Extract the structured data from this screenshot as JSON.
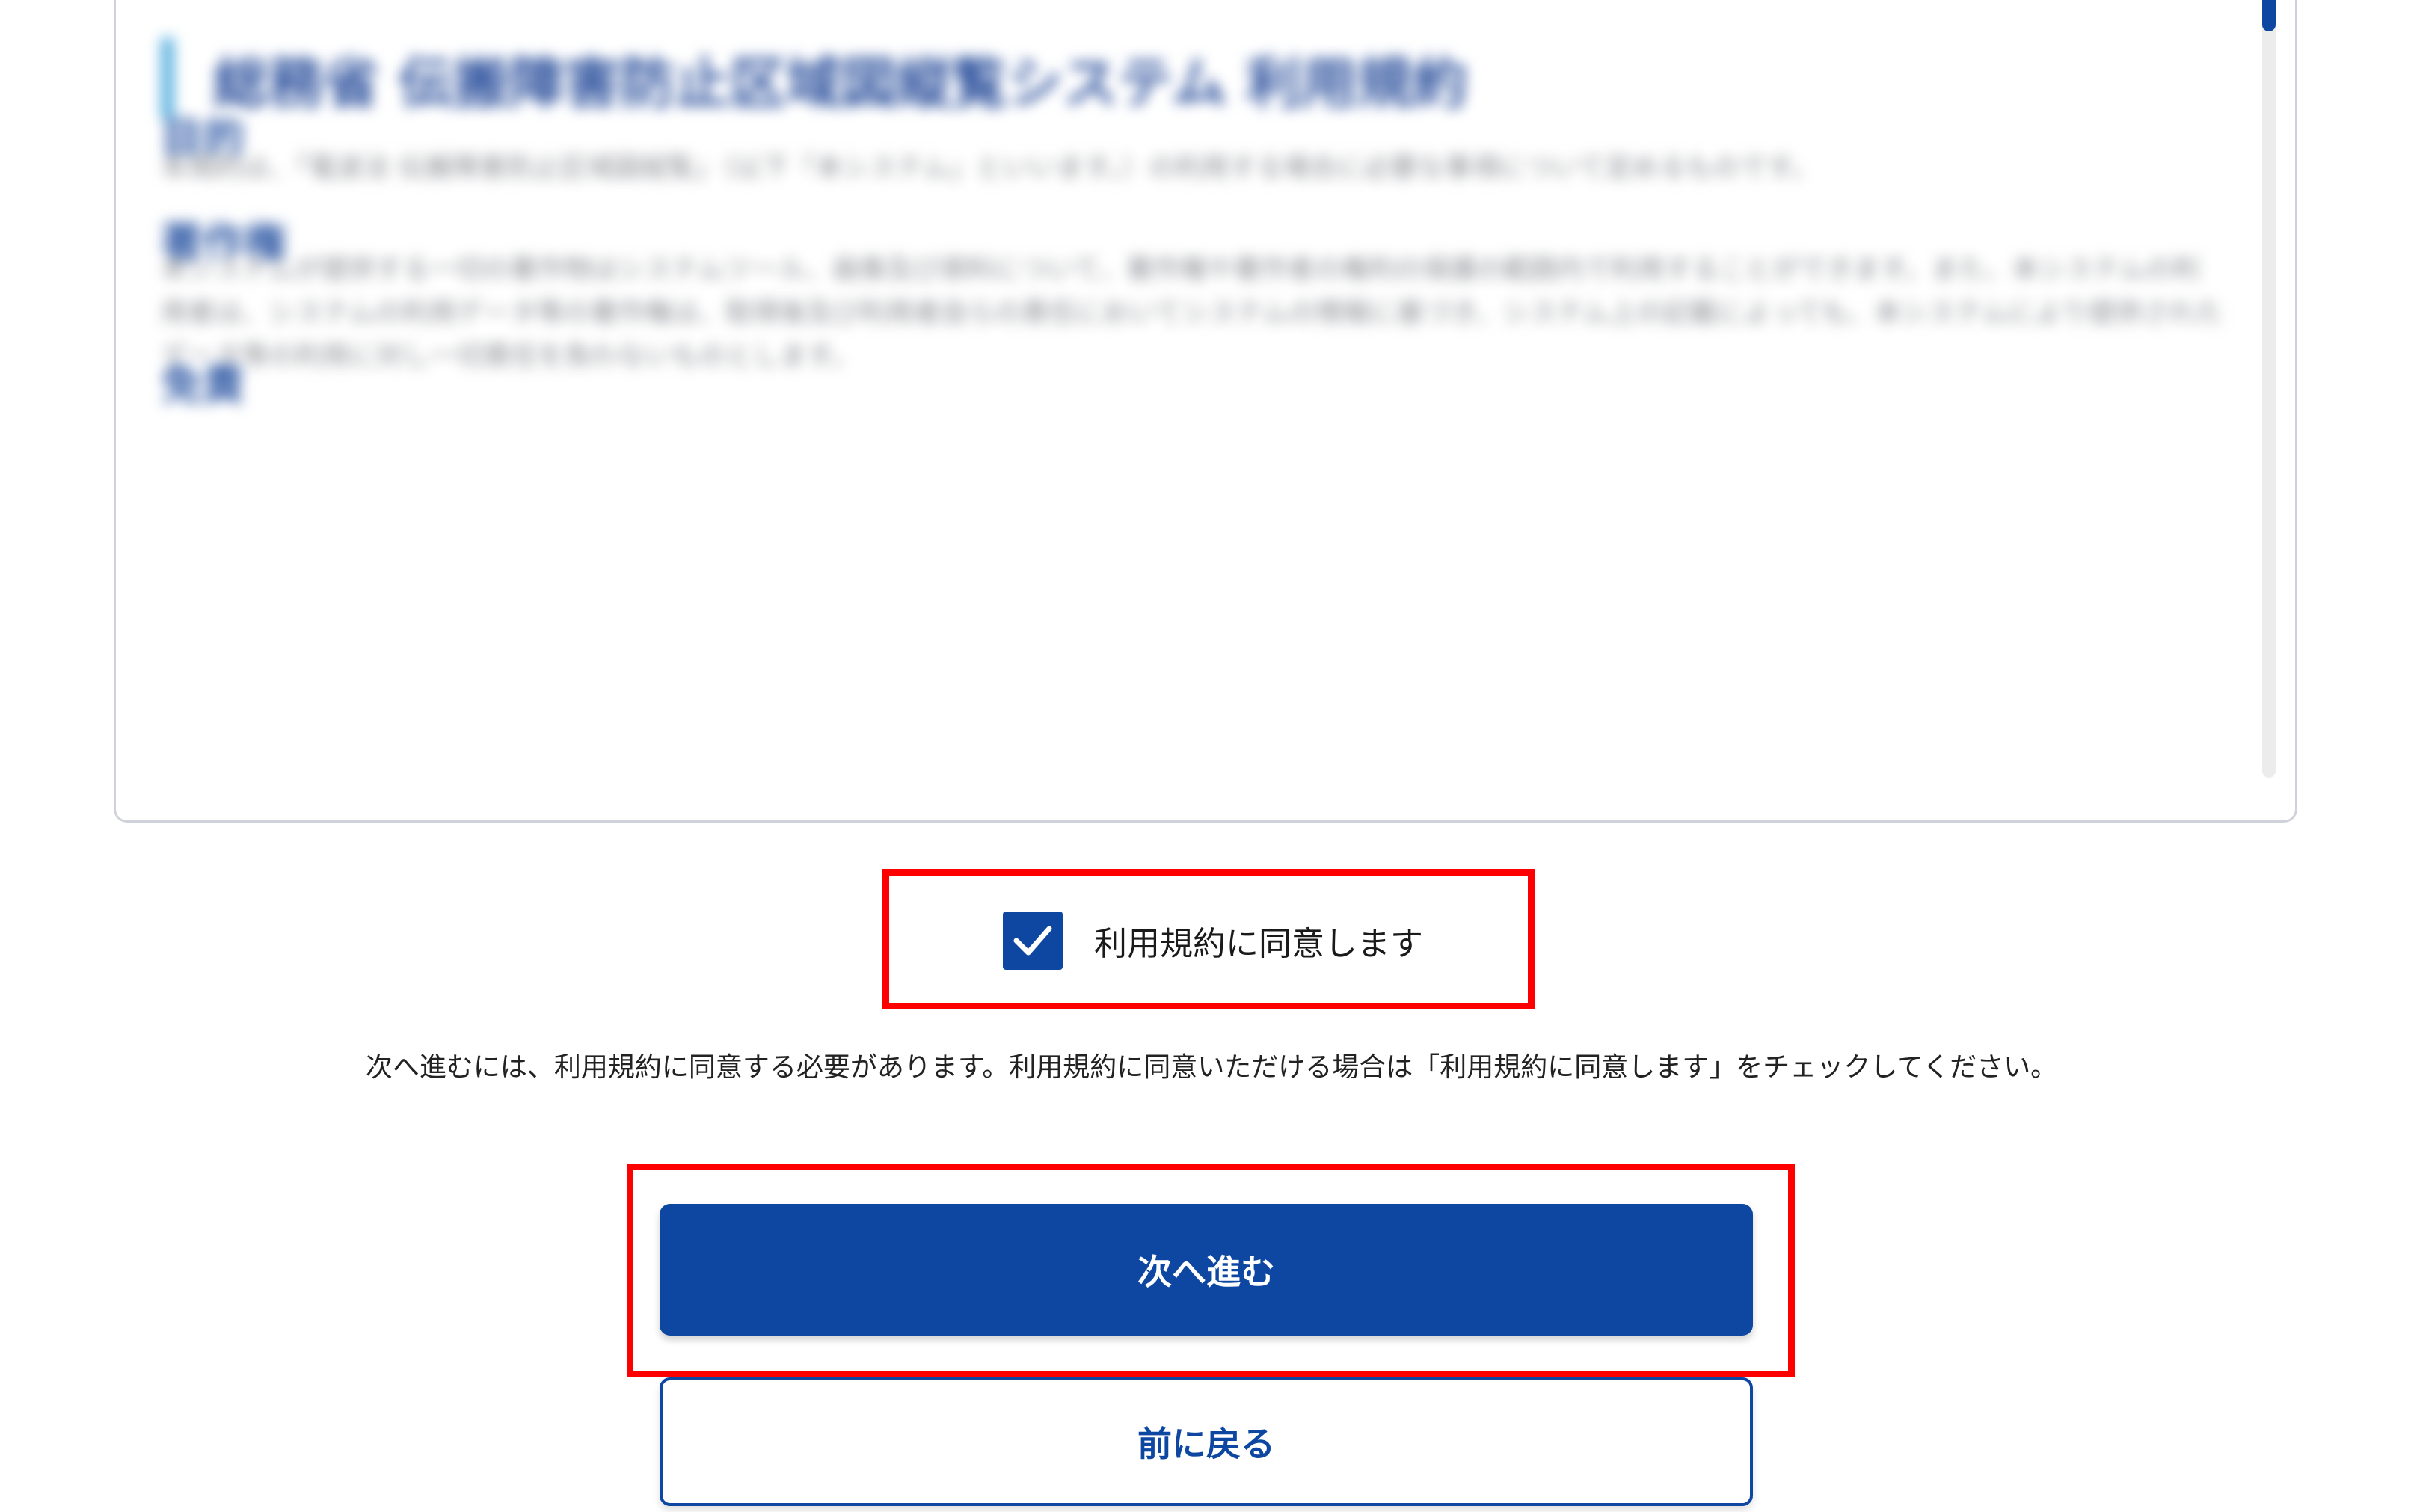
{
  "terms": {
    "title": "総務省 伝搬障害防止区域図縦覧システム 利用規約",
    "sections": [
      {
        "heading": "目的",
        "body": "本規約は、「電波法 伝搬障害防止区域図縦覧」（以下「本システム」といいます。）の利用する場合に必要な事項について定めるものです。"
      },
      {
        "heading": "著作権",
        "body": "本システムが提供する一切の著作物はシステムツール、画像及び資料について、著作権や著作者の権利の保護の範囲内で利用することができます。また、本システムの利用者は、システムの利用データ等の著作権は、取得後及び利用者自らの責任においてシステムの情報に基づき、システム上の記載によっても、本システムにより提供されたデータ等の利用に対し一切責任を負わないものとします。"
      },
      {
        "heading": "免責",
        "body": ""
      }
    ]
  },
  "agreement": {
    "label": "利用規約に同意します",
    "checked": true,
    "notice": "次へ進むには、利用規約に同意する必要があります。利用規約に同意いただける場合は「利用規約に同意します」をチェックしてください。"
  },
  "buttons": {
    "next_label": "次へ進む",
    "back_label": "前に戻る"
  },
  "colors": {
    "primary": "#0d47a1",
    "highlight": "#ff0000",
    "title_accent": "#5fb3e0"
  }
}
